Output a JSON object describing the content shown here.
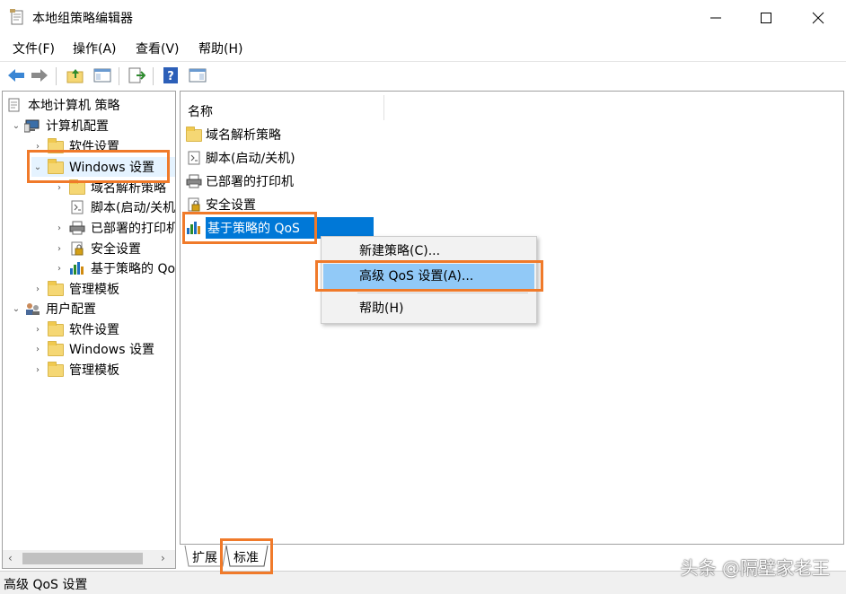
{
  "window": {
    "title": "本地组策略编辑器",
    "controls": {
      "minimize": "minimize-icon",
      "maximize": "maximize-icon",
      "close": "close-icon"
    }
  },
  "menu": [
    "文件(F)",
    "操作(A)",
    "查看(V)",
    "帮助(H)"
  ],
  "toolbar": {
    "icons": [
      "back-icon",
      "forward-icon",
      "up-folder-icon",
      "show-hide-tree-icon",
      "export-list-icon",
      "help-icon",
      "properties-pane-icon"
    ]
  },
  "tree": {
    "root": "本地计算机 策略",
    "computer_config": "计算机配置",
    "computer_software": "软件设置",
    "computer_windows": "Windows 设置",
    "win_dns": "域名解析策略",
    "win_scripts": "脚本(启动/关机)",
    "win_printers": "已部署的打印机",
    "win_security": "安全设置",
    "win_qos": "基于策略的 QoS",
    "computer_admin": "管理模板",
    "user_config": "用户配置",
    "user_software": "软件设置",
    "user_windows": "Windows 设置",
    "user_admin": "管理模板"
  },
  "list": {
    "column_name": "名称",
    "items": [
      "域名解析策略",
      "脚本(启动/关机)",
      "已部署的打印机",
      "安全设置",
      "基于策略的 QoS"
    ]
  },
  "context_menu": {
    "items": [
      "新建策略(C)...",
      "高级 QoS 设置(A)...",
      "帮助(H)"
    ]
  },
  "tabs": [
    "扩展",
    "标准"
  ],
  "status": "高级 QoS 设置",
  "watermark": "头条 @隔壁家老王",
  "colors": {
    "selection": "#0078d7",
    "menu_hover": "#91c9f7",
    "highlight_box": "#f07a2a"
  }
}
